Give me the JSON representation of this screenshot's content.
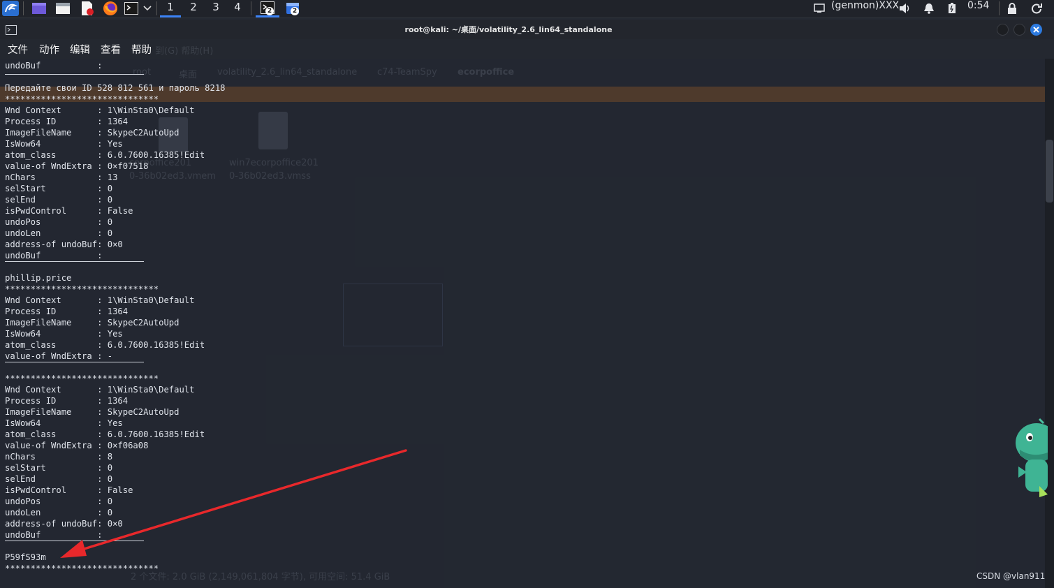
{
  "taskbar": {
    "workspaces": [
      "1",
      "2",
      "3",
      "4"
    ],
    "active_workspace": "1",
    "terminal_count": "2",
    "browser_count": "2",
    "user_label": "(genmon)XXX",
    "clock": "0:54",
    "icons": [
      "kali-menu-icon",
      "workspace-switcher-icon",
      "file-manager-icon",
      "text-editor-icon",
      "firefox-icon",
      "terminal-icon",
      "chevron-down-icon",
      "terminal-task-icon",
      "browser-task-icon",
      "display-icon",
      "volume-icon",
      "bell-icon",
      "battery-icon",
      "lock-icon",
      "logout-icon"
    ]
  },
  "window": {
    "title": "root@kali: ~/桌面/volatility_2.6_lin64_standalone",
    "menu": [
      "文件",
      "动作",
      "编辑",
      "查看",
      "帮助"
    ]
  },
  "background_ghost": {
    "menu_hint": "到(G)   帮助(H)",
    "path_items": [
      "root",
      "桌面",
      "volatility_2.6_lin64_standalone",
      "c74-TeamSpy",
      "ecorpoffice"
    ],
    "file1": "corpoffice201\n0-36b02ed3.vmem",
    "file2": "win7ecorpoffice201\n0-36b02ed3.vmss",
    "status": "2 个文件: 2.0 GiB (2,149,061,804 字节), 可用空间: 51.4 GiB"
  },
  "terminal": {
    "lines": [
      "undoBuf           :",
      "Передайте свои ID 528 812 561 и пароль 8218",
      "******************************",
      "Wnd Context       : 1\\WinSta0\\Default",
      "Process ID        : 1364",
      "ImageFileName     : SkypeC2AutoUpd",
      "IsWow64           : Yes",
      "atom_class        : 6.0.7600.16385!Edit",
      "value-of WndExtra : 0×f07518",
      "nChars            : 13",
      "selStart          : 0",
      "selEnd            : 0",
      "isPwdControl      : False",
      "undoPos           : 0",
      "undoLen           : 0",
      "address-of undoBuf: 0×0",
      "undoBuf           :",
      "phillip.price",
      "******************************",
      "Wnd Context       : 1\\WinSta0\\Default",
      "Process ID        : 1364",
      "ImageFileName     : SkypeC2AutoUpd",
      "IsWow64           : Yes",
      "atom_class        : 6.0.7600.16385!Edit",
      "value-of WndExtra : -",
      "******************************",
      "Wnd Context       : 1\\WinSta0\\Default",
      "Process ID        : 1364",
      "ImageFileName     : SkypeC2AutoUpd",
      "IsWow64           : Yes",
      "atom_class        : 6.0.7600.16385!Edit",
      "value-of WndExtra : 0×f06a08",
      "nChars            : 8",
      "selStart          : 0",
      "selEnd            : 0",
      "isPwdControl      : False",
      "undoPos           : 0",
      "undoLen           : 0",
      "address-of undoBuf: 0×0",
      "undoBuf           :",
      "P59fS93m",
      "******************************"
    ]
  },
  "watermark": "CSDN @vlan911",
  "colors": {
    "terminal_bg": "#232831",
    "highlight_row": "#4e3a2c",
    "annotation_arrow": "#e8282b",
    "accent": "#3b82f6"
  }
}
